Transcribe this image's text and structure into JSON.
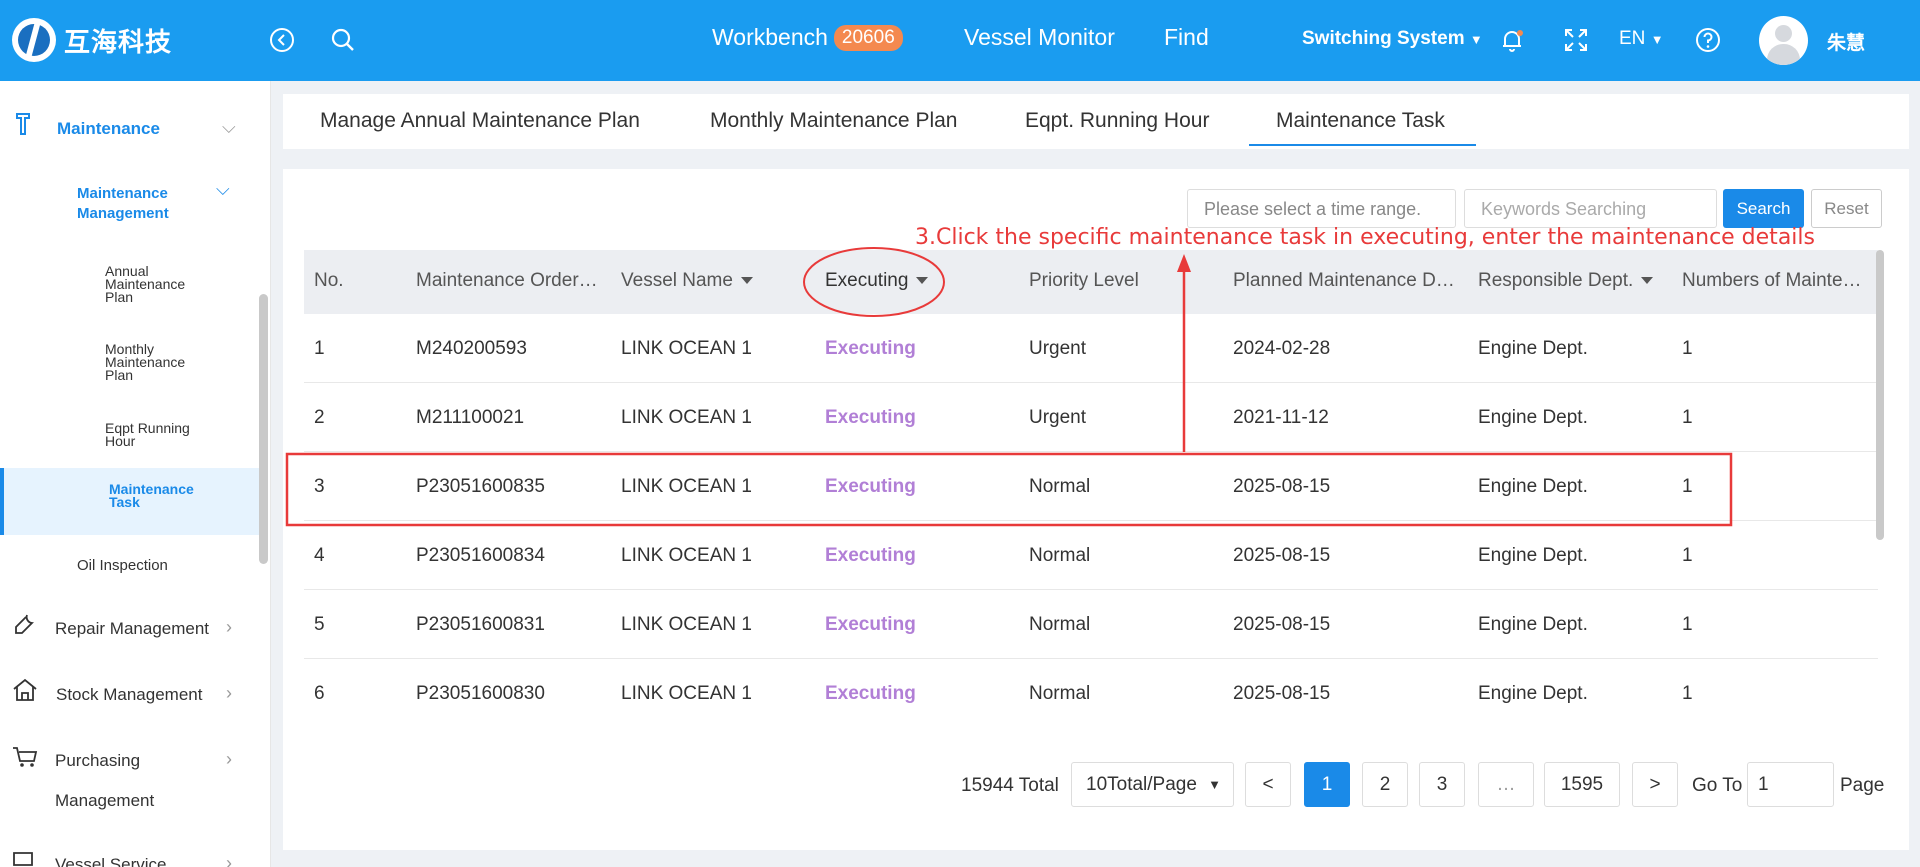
{
  "header": {
    "logo_text": "互海科技",
    "nav": [
      {
        "label": "Workbench",
        "badge": "20606"
      },
      {
        "label": "Vessel Monitor"
      },
      {
        "label": "Find"
      }
    ],
    "switch_label": "Switching System",
    "lang": "EN",
    "user_name": "朱慧"
  },
  "sidebar": {
    "maintenance": "Maintenance",
    "maintenance_management_line1": "Maintenance",
    "maintenance_management_line2": "Management",
    "annual_plan": [
      "Annual",
      "Maintenance",
      "Plan"
    ],
    "monthly_plan": [
      "Monthly",
      "Maintenance",
      "Plan"
    ],
    "running_hour": [
      "Eqpt Running",
      "Hour"
    ],
    "maintenance_task": [
      "Maintenance",
      "Task"
    ],
    "oil_inspection": "Oil Inspection",
    "repair": "Repair Management",
    "stock": "Stock Management",
    "purchasing_line1": "Purchasing",
    "purchasing_line2": "Management",
    "vessel_service": "Vessel Service"
  },
  "tabs": [
    "Manage Annual Maintenance Plan",
    "Monthly Maintenance Plan",
    "Eqpt. Running Hour",
    "Maintenance Task"
  ],
  "filters": {
    "time_placeholder": "Please select a time range.",
    "keyword_placeholder": "Keywords Searching",
    "search": "Search",
    "reset": "Reset"
  },
  "annotation": "3.Click the specific maintenance task in executing, enter the maintenance details",
  "table": {
    "headers": [
      "No.",
      "Maintenance Order…",
      "Vessel Name",
      "Executing",
      "Priority Level",
      "Planned Maintenance D…",
      "Responsible Dept.",
      "Numbers of Mainte…"
    ],
    "rows": [
      {
        "no": "1",
        "order": "M240200593",
        "vessel": "LINK OCEAN 1",
        "status": "Executing",
        "priority": "Urgent",
        "date": "2024-02-28",
        "dept": "Engine Dept.",
        "count": "1"
      },
      {
        "no": "2",
        "order": "M211100021",
        "vessel": "LINK OCEAN 1",
        "status": "Executing",
        "priority": "Urgent",
        "date": "2021-11-12",
        "dept": "Engine Dept.",
        "count": "1"
      },
      {
        "no": "3",
        "order": "P23051600835",
        "vessel": "LINK OCEAN 1",
        "status": "Executing",
        "priority": "Normal",
        "date": "2025-08-15",
        "dept": "Engine Dept.",
        "count": "1"
      },
      {
        "no": "4",
        "order": "P23051600834",
        "vessel": "LINK OCEAN 1",
        "status": "Executing",
        "priority": "Normal",
        "date": "2025-08-15",
        "dept": "Engine Dept.",
        "count": "1"
      },
      {
        "no": "5",
        "order": "P23051600831",
        "vessel": "LINK OCEAN 1",
        "status": "Executing",
        "priority": "Normal",
        "date": "2025-08-15",
        "dept": "Engine Dept.",
        "count": "1"
      },
      {
        "no": "6",
        "order": "P23051600830",
        "vessel": "LINK OCEAN 1",
        "status": "Executing",
        "priority": "Normal",
        "date": "2025-08-15",
        "dept": "Engine Dept.",
        "count": "1"
      }
    ]
  },
  "pagination": {
    "total": "15944 Total",
    "page_size": "10Total/Page",
    "prev": "<",
    "pages": [
      "1",
      "2",
      "3",
      "…",
      "1595"
    ],
    "next": ">",
    "goto_label": "Go To",
    "goto_value": "1",
    "page_label": "Page"
  },
  "colors": {
    "topbar": "#1a9cf0",
    "accent": "#1a8ae8",
    "executing": "#b17fd6",
    "annotation": "#e83a3a",
    "badge": "#f4894f"
  }
}
